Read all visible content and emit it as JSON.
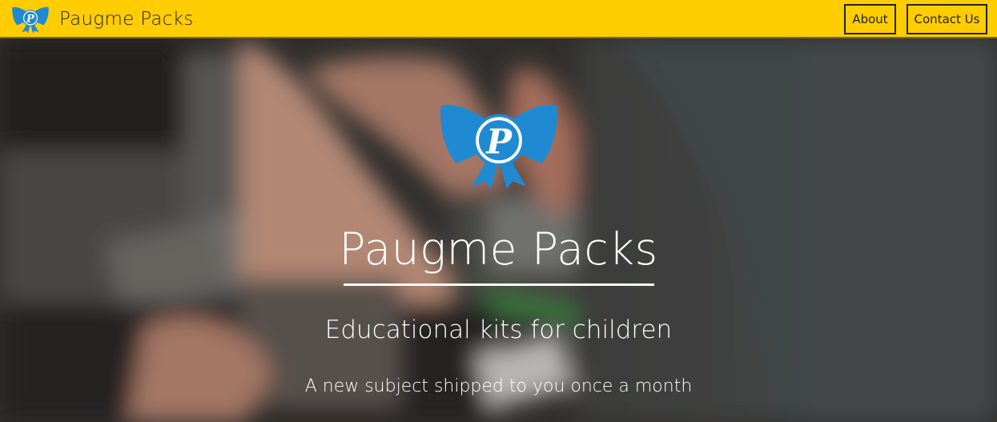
{
  "navbar": {
    "brand_title": "Paugme Packs",
    "logo_icon": "bow-p-logo-icon",
    "links": [
      {
        "label": "About"
      },
      {
        "label": "Contact Us"
      }
    ],
    "background_color": "#ffcd02"
  },
  "hero": {
    "logo_icon": "bow-p-logo-icon",
    "title": "Paugme Packs",
    "subtitle": "Educational kits for children",
    "tagline": "A new subject shipped to you once a month",
    "logo_color": "#1f8ad2"
  }
}
